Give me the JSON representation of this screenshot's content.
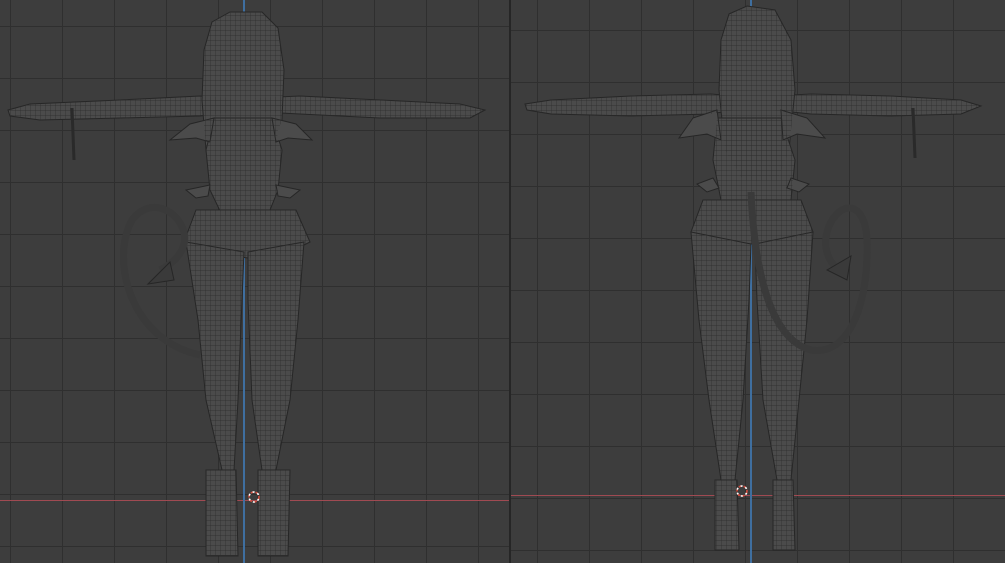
{
  "colors": {
    "grid_bg": "#3d3d3d",
    "grid_line": "#2f2f2f",
    "x_axis": "#a04a52",
    "z_axis": "#3f6fa0",
    "mesh_fill": "#4a4a4a",
    "mesh_wire": "#2a2a2a",
    "cursor_red": "#d24b3c",
    "cursor_white": "#ffffff"
  },
  "viewports": [
    {
      "id": "front",
      "view": "front-orthographic",
      "shows": "character-model-front"
    },
    {
      "id": "back",
      "view": "back-orthographic",
      "shows": "character-model-back"
    }
  ],
  "icons": {
    "cursor": "3d-cursor-icon"
  }
}
